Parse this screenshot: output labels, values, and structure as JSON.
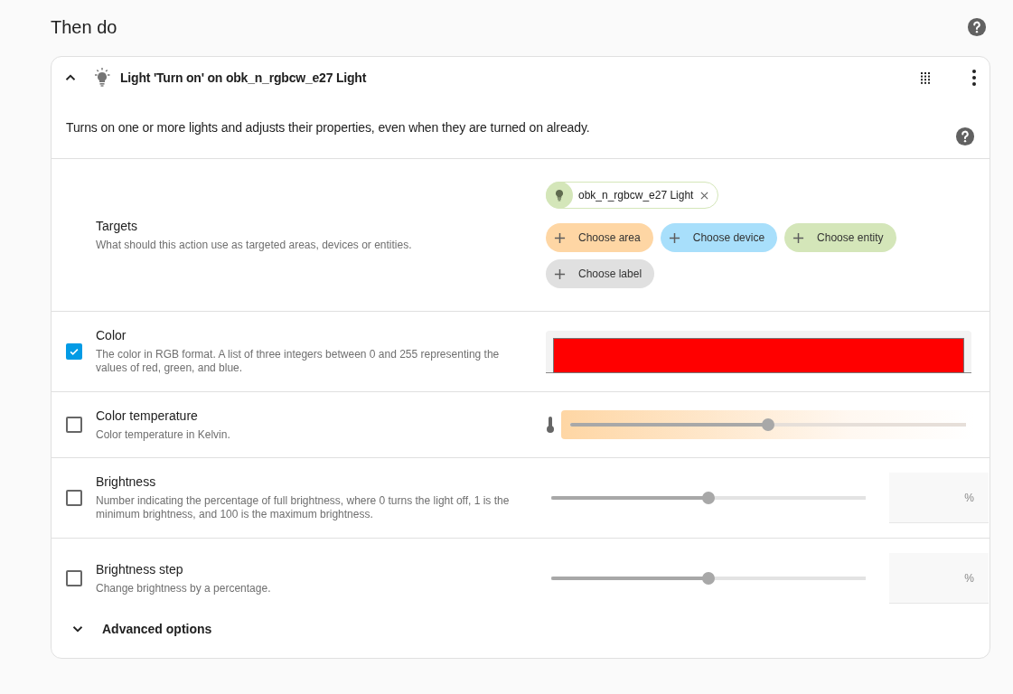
{
  "heading": "Then do",
  "card": {
    "expanded": true,
    "title": "Light 'Turn on' on obk_n_rgbcw_e27 Light",
    "description": "Turns on one or more lights and adjusts their properties, even when they are turned on already."
  },
  "fields": [
    {
      "kind": "targets",
      "label": "Targets",
      "helper": "What should this action use as targeted areas, devices or entities.",
      "selected_targets": [
        {
          "label": "obk_n_rgbcw_e27 Light",
          "color": "#d4e6b9"
        }
      ],
      "add_buttons": [
        {
          "label": "Choose area",
          "color": "#fed6a4"
        },
        {
          "label": "Choose device",
          "color": "#a8dffb"
        },
        {
          "label": "Choose entity",
          "color": "#d4e6b9"
        },
        {
          "label": "Choose label",
          "color": "#e0e0e0"
        }
      ]
    },
    {
      "kind": "color",
      "label": "Color",
      "helper": "The color in RGB format. A list of three integers between 0 and 255 representing the values of red, green, and blue.",
      "checked": true,
      "color": "#ff0000"
    },
    {
      "kind": "temperature",
      "label": "Color temperature",
      "helper": "Color temperature in Kelvin.",
      "checked": false,
      "level": 0.5
    },
    {
      "kind": "number",
      "label": "Brightness",
      "helper": "Number indicating the percentage of full brightness, where 0 turns the light off, 1 is the minimum brightness, and 100 is the maximum brightness.",
      "checked": false,
      "level": 0.5,
      "suffix": "%"
    },
    {
      "kind": "number",
      "label": "Brightness step",
      "helper": "Change brightness by a percentage.",
      "checked": false,
      "level": 0.5,
      "suffix": "%"
    }
  ],
  "advanced": {
    "label": "Advanced options",
    "expanded": false
  }
}
